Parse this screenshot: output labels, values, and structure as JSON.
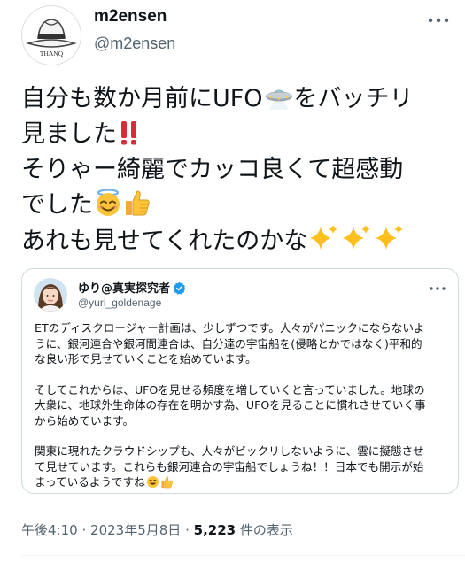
{
  "author": {
    "display_name": "m2ensen",
    "handle": "@m2ensen",
    "avatar_text": "THANQ"
  },
  "tweet": {
    "line1": "自分も数か月前にUFO",
    "line1_after": "をバッチリ",
    "line2": "見ました",
    "line3": "そりゃー綺麗でカッコ良くて超感動",
    "line4": "でした",
    "line5": "あれも見せてくれたのかな",
    "emoji": [
      "ufo-icon",
      "double-exclamation-icon",
      "smiling-halo-icon",
      "thumbs-up-icon",
      "sparkles-icon"
    ]
  },
  "quoted": {
    "display_name": "ゆり@真実探究者",
    "handle": "@yuri_goldenage",
    "lines": [
      "ETのディスクロージャー計画は、少しずつです。人々がパニックにならないよ",
      "うに、銀河連合や銀河間連合は、自分達の宇宙船を(侵略とかではなく)平和的",
      "な良い形で見せていくことを始めています。",
      "",
      "そしてこれからは、UFOを見せる頻度を増していくと言っていました。地球の",
      "大衆に、地球外生命体の存在を明かす為、UFOを見ることに慣れさせていく事",
      "から始めています。",
      "",
      "関東に現れたクラウドシップも、人々がビックリしないように、雲に擬態させ",
      "て見せています。これらも銀河連合の宇宙船でしょうね！！日本でも開示が始",
      "まっているようですね"
    ]
  },
  "meta": {
    "time": "午後4:10",
    "separator": "·",
    "date": "2023年5月8日",
    "views_count": "5,223",
    "views_label": "件の表示"
  },
  "colors": {
    "text": "#0f1419",
    "secondary": "#536471",
    "border": "#cfd9de",
    "verified": "#1d9bf0"
  }
}
